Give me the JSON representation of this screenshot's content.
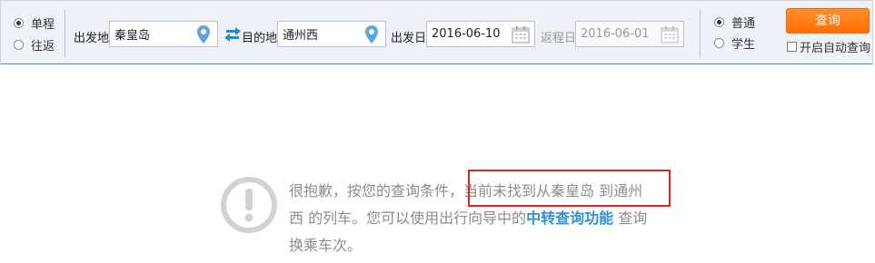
{
  "trip_type": {
    "options": [
      {
        "label": "单程",
        "checked": true
      },
      {
        "label": "往返",
        "checked": false
      }
    ]
  },
  "from": {
    "label": "出发地",
    "value": "秦皇岛",
    "icon": "location-pin-icon"
  },
  "swap": {
    "icon": "swap-arrows-icon"
  },
  "to": {
    "label": "目的地",
    "value": "通州西",
    "icon": "location-pin-icon"
  },
  "depart": {
    "label": "出发日",
    "value": "2016-06-10",
    "icon": "calendar-icon"
  },
  "return": {
    "label": "返程日",
    "value": "2016-06-01",
    "icon": "calendar-icon"
  },
  "passenger_type": {
    "options": [
      {
        "label": "普通",
        "checked": true
      },
      {
        "label": "学生",
        "checked": false
      }
    ]
  },
  "query_button": {
    "label": "查询"
  },
  "auto_query": {
    "label": "开启自动查询",
    "checked": false
  },
  "result": {
    "icon": "exclamation-circle-icon",
    "line1_prefix": "很抱歉，按您的查询条件，",
    "line1_highlight": "当前未找到从秦皇岛 到通州",
    "line2_prefix": "西 的列车。您可以使用出行向导中的",
    "link": "中转查询功能",
    "line2_suffix": " 查询",
    "line3": "换乘车次。"
  },
  "colors": {
    "accent_orange": "#ff7b1a",
    "link_blue": "#2e8fd6",
    "highlight_red": "#dd2424",
    "bar_background": "#eef1f8"
  }
}
